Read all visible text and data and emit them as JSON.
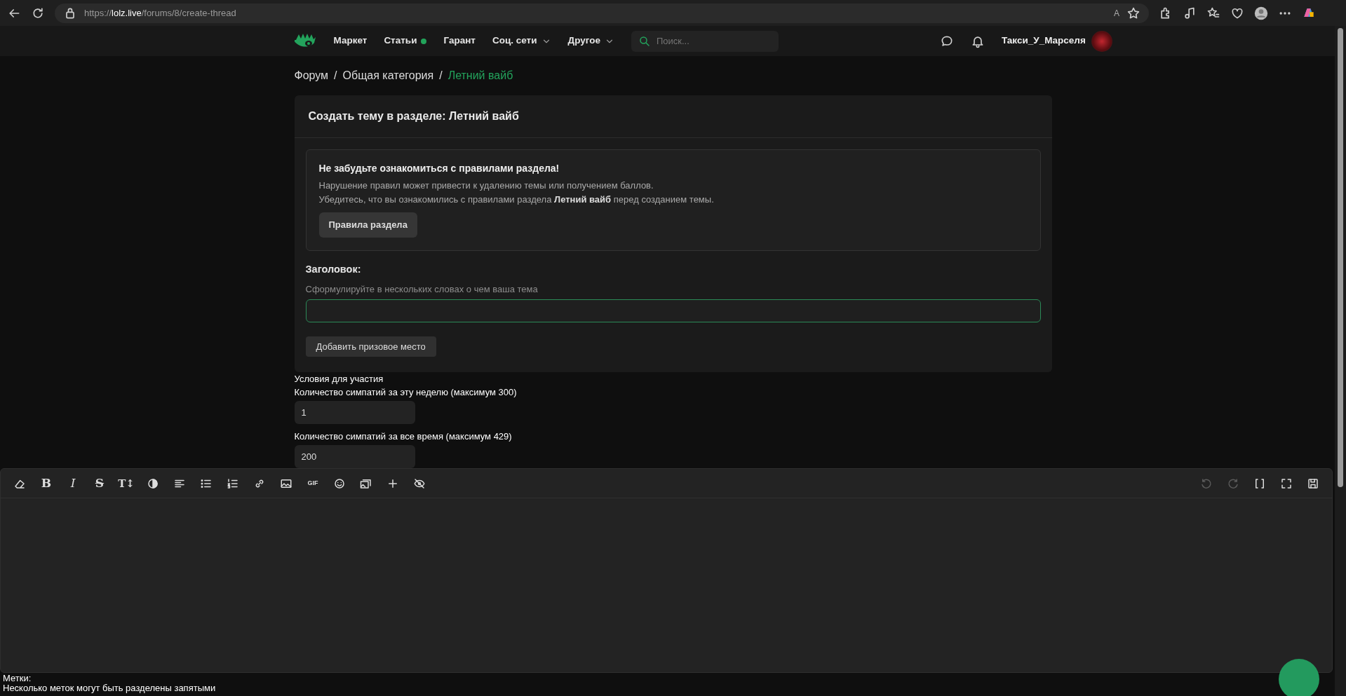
{
  "browser": {
    "url": "https://**lolz.live**/forums/8/create-thread",
    "read_aloud": "A"
  },
  "header": {
    "nav": [
      {
        "label": "Маркет",
        "kind": "plain"
      },
      {
        "label": "Статьи",
        "kind": "dot"
      },
      {
        "label": "Гарант",
        "kind": "plain"
      },
      {
        "label": "Соц. сети",
        "kind": "dropdown"
      },
      {
        "label": "Другое",
        "kind": "dropdown"
      }
    ],
    "search": {
      "placeholder": "Поиск..."
    },
    "username": "Такси_У_Марселя"
  },
  "breadcrumb": [
    {
      "label": "Форум",
      "selected": false
    },
    {
      "label": "Общая категория",
      "selected": false
    },
    {
      "label": "Летний вайб",
      "selected": true
    }
  ],
  "breadcrumb_separator": "/",
  "card": {
    "title": "Создать тему в разделе: Летний вайб",
    "notice": {
      "heading": "Не забудьте ознакомиться с правилами раздела!",
      "lines": [
        "Нарушение правил может привести к удалению темы или получением баллов.",
        "Убедитесь, что вы ознакомились с правилами раздела **Летний вайб** перед созданием темы."
      ],
      "button": "Правила раздела"
    },
    "title_label": "Заголовок:",
    "title_hint": "Сформулируйте в нескольких словах о чем ваша тема",
    "title_field": {
      "focused": true
    },
    "prize_button": "Добавить призовое место"
  },
  "conditions": {
    "heading": "Условия для участия",
    "fields": [
      {
        "label": "Количество симпатий за эту неделю (максимум 300)",
        "value": "1"
      },
      {
        "label": "Количество симпатий за все время (максимум 429)",
        "value": "200"
      }
    ]
  },
  "editor": {
    "tools_left": [
      {
        "kind": "eraser"
      },
      {
        "kind": "bold",
        "label": "B"
      },
      {
        "kind": "italic",
        "label": "I"
      },
      {
        "kind": "strike",
        "label": "S"
      },
      {
        "kind": "size",
        "label": "T↕"
      },
      {
        "kind": "contrast"
      },
      {
        "kind": "align"
      },
      {
        "kind": "bullets"
      },
      {
        "kind": "numbers"
      },
      {
        "kind": "link"
      },
      {
        "kind": "image"
      },
      {
        "kind": "gif",
        "label": "GIF"
      },
      {
        "kind": "smile"
      },
      {
        "kind": "gallery"
      },
      {
        "kind": "plus"
      },
      {
        "kind": "hide"
      }
    ],
    "tools_right": [
      {
        "kind": "undo",
        "disabled": true
      },
      {
        "kind": "redo",
        "disabled": true
      },
      {
        "kind": "brackets",
        "disabled": false
      },
      {
        "kind": "fullscreen",
        "disabled": false
      },
      {
        "kind": "save",
        "disabled": false
      }
    ]
  },
  "tags": {
    "label": "Метки:",
    "hint": "Несколько меток могут быть разделены запятыми"
  }
}
